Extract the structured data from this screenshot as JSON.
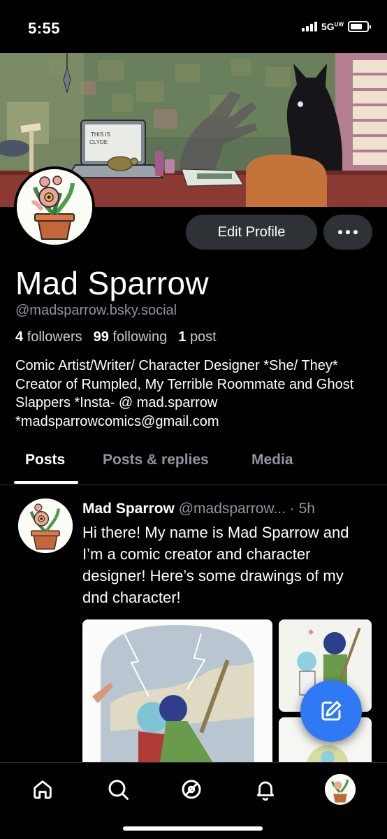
{
  "status_bar": {
    "time": "5:55",
    "network": "5G",
    "network_suffix": "UW"
  },
  "profile": {
    "display_name": "Mad Sparrow",
    "handle": "@madsparrow.bsky.social",
    "followers_count": "4",
    "followers_label": "followers",
    "following_count": "99",
    "following_label": "following",
    "posts_count": "1",
    "posts_label": "post",
    "bio": "Comic Artist/Writer/ Character Designer *She/ They* Creator of Rumpled, My Terrible Roommate and Ghost Slappers *Insta- @ mad.sparrow *madsparrowcomics@gmail.com",
    "edit_label": "Edit Profile",
    "banner_laptop_text_1": "THIS IS",
    "banner_laptop_text_2": "CLYDE"
  },
  "tabs": [
    {
      "label": "Posts",
      "active": true
    },
    {
      "label": "Posts & replies",
      "active": false
    },
    {
      "label": "Media",
      "active": false
    }
  ],
  "post": {
    "author_name": "Mad Sparrow",
    "author_handle": "@madsparrow...",
    "time": "· 5h",
    "text": "Hi there! My name is Mad Sparrow and I’m a comic creator and character designer! Here’s some drawings of my dnd character!"
  },
  "colors": {
    "background": "#000000",
    "button_bg": "#2e3136",
    "accent": "#2f79f5",
    "muted_text": "#8e959e"
  },
  "icons": {
    "nav": [
      "home-icon",
      "search-icon",
      "feeds-icon",
      "notifications-icon",
      "profile-avatar"
    ],
    "fab": "compose-icon",
    "more": "more-dots-icon"
  }
}
